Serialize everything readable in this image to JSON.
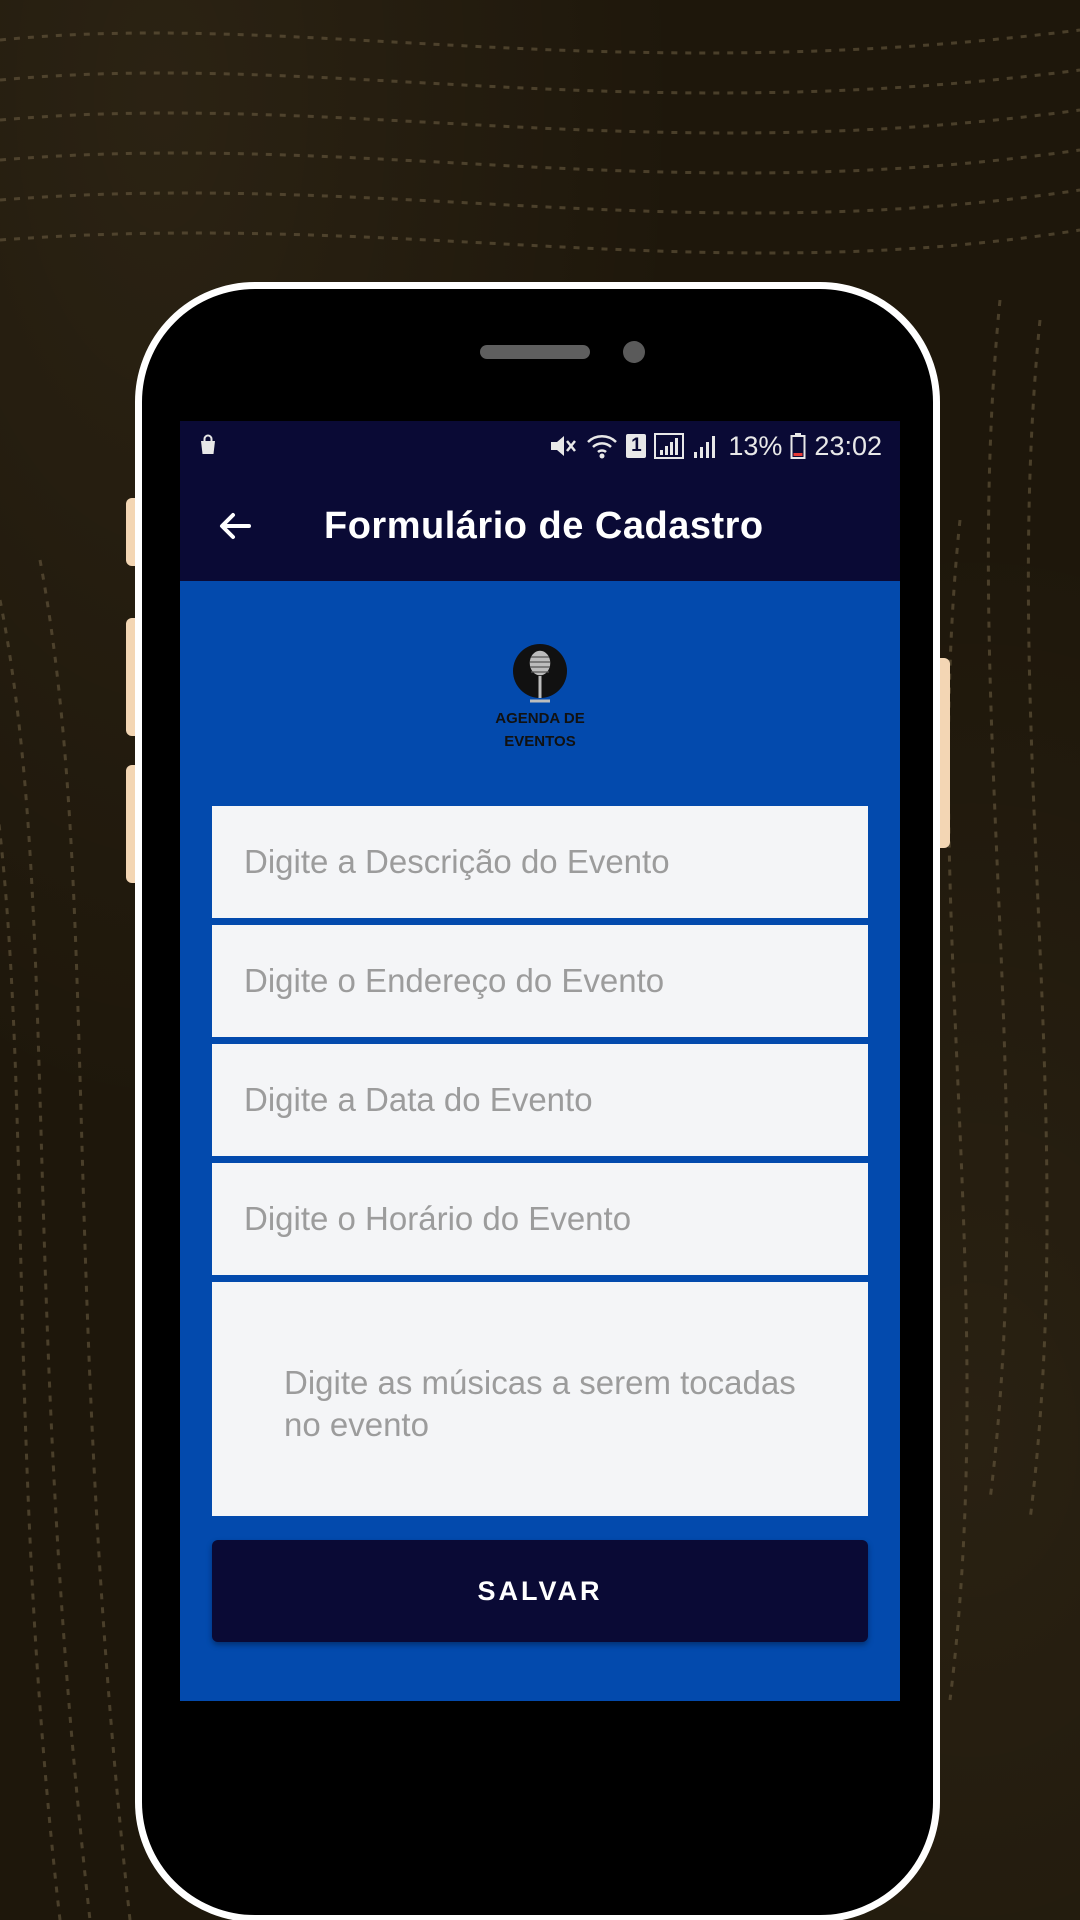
{
  "status_bar": {
    "battery_percent": "13%",
    "sim_badge": "1",
    "time": "23:02",
    "icons": [
      "shopping-bag-icon",
      "mute-icon",
      "wifi-icon",
      "sim-icon",
      "signal-icon",
      "signal-icon",
      "battery-icon"
    ]
  },
  "app_bar": {
    "title": "Formulário de Cadastro",
    "back_icon": "arrow-left-icon"
  },
  "logo": {
    "icon": "microphone-icon",
    "line1": "AGENDA DE",
    "line2": "EVENTOS"
  },
  "form": {
    "description_placeholder": "Digite a Descrição do Evento",
    "address_placeholder": "Digite o Endereço do Evento",
    "date_placeholder": "Digite a Data do Evento",
    "time_placeholder": "Digite o Horário do Evento",
    "songs_placeholder": "Digite as músicas a serem tocadas no evento",
    "save_label": "SALVAR"
  },
  "colors": {
    "background": "#1e170b",
    "app_bar": "#0a0a35",
    "screen": "#034aad",
    "field": "#f4f5f7",
    "phone_frame": "#ffffff",
    "side_buttons": "#f3d6b4"
  }
}
